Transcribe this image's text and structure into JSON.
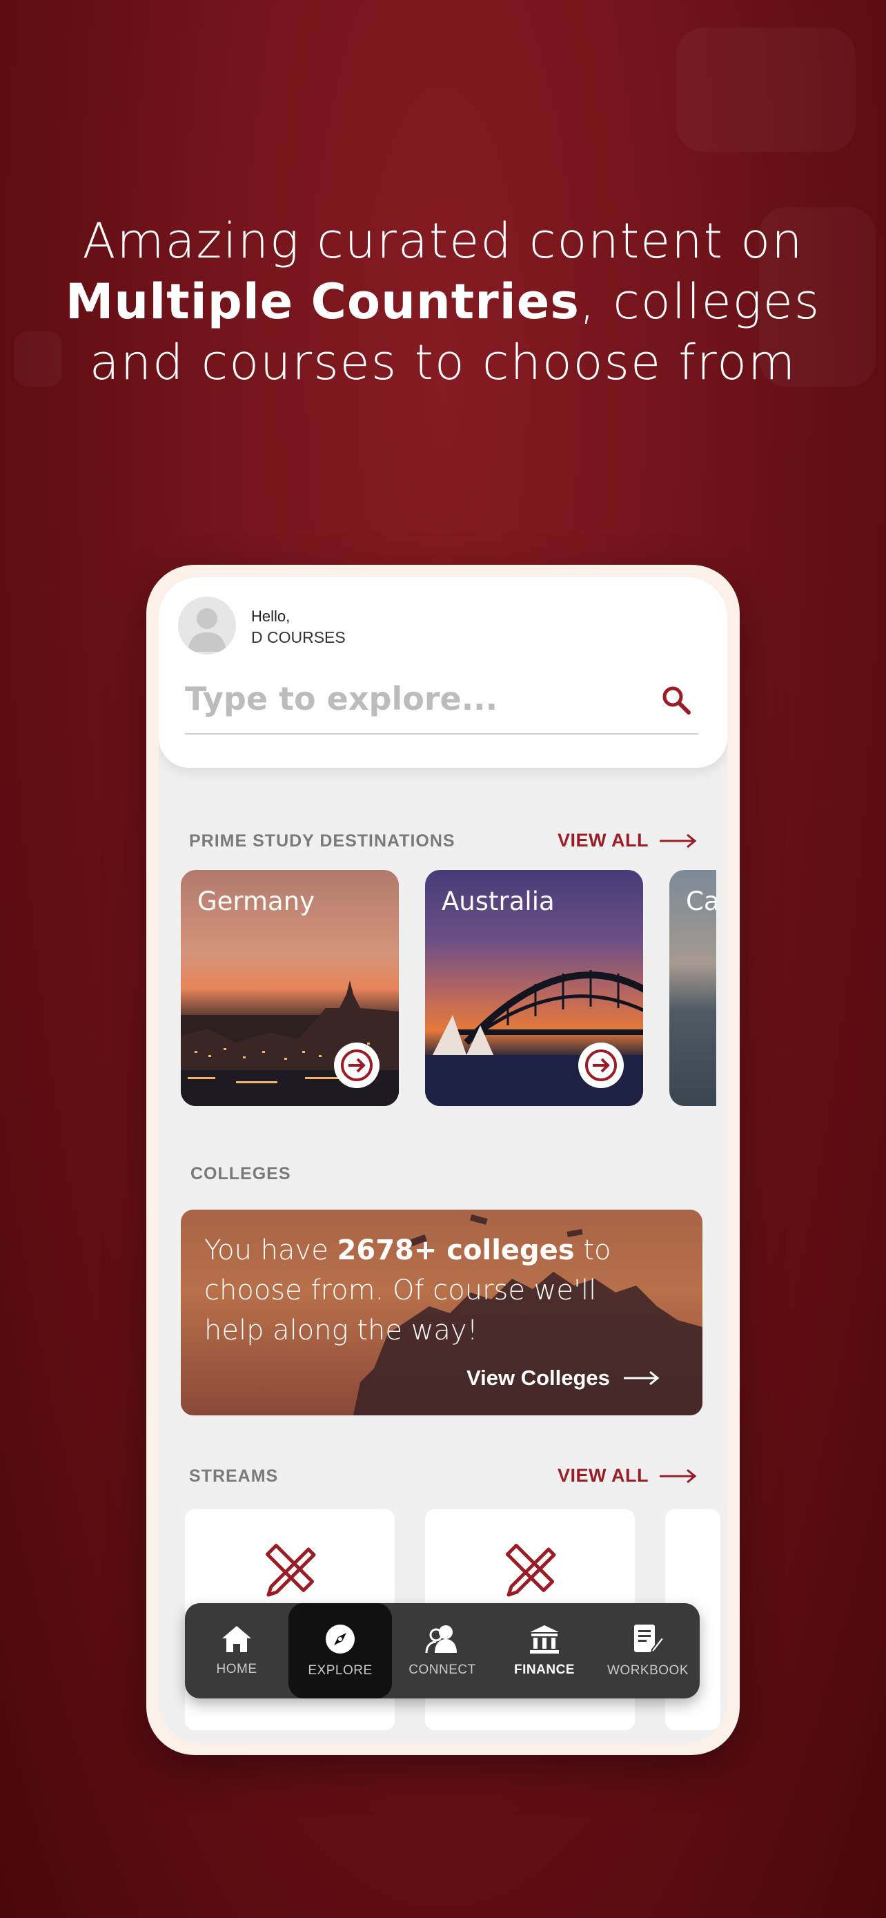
{
  "headline": {
    "line1": "Amazing curated content on",
    "line2_bold": "Multiple Countries",
    "line2_rest": ", colleges",
    "line3": "and courses to choose from"
  },
  "header": {
    "greeting": "Hello,",
    "user_name": "D COURSES"
  },
  "search": {
    "placeholder": "Type to explore..."
  },
  "destinations": {
    "title": "PRIME STUDY DESTINATIONS",
    "view_all": "VIEW ALL",
    "items": [
      {
        "name": "Germany"
      },
      {
        "name": "Australia"
      },
      {
        "name": "Ca"
      }
    ]
  },
  "colleges": {
    "title": "COLLEGES",
    "text_before": "You have ",
    "text_bold": "2678+ colleges",
    "text_after": " to choose from. Of course we'll help along the way!",
    "cta": "View Colleges"
  },
  "streams": {
    "title": "STREAMS",
    "view_all": "VIEW ALL"
  },
  "nav": {
    "items": [
      {
        "label": "HOME",
        "icon": "home-icon"
      },
      {
        "label": "EXPLORE",
        "icon": "compass-icon",
        "active": true
      },
      {
        "label": "CONNECT",
        "icon": "connect-icon"
      },
      {
        "label": "FINANCE",
        "icon": "bank-icon"
      },
      {
        "label": "WORKBOOK",
        "icon": "workbook-icon"
      }
    ]
  },
  "colors": {
    "accent": "#9a1c24",
    "background": "#6e1219",
    "nav": "#3a3a3a"
  }
}
